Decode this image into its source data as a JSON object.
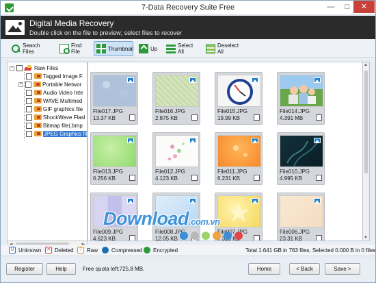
{
  "window": {
    "title": "7-Data Recovery Suite Free",
    "min": "—",
    "max": "□",
    "close": "✕"
  },
  "header": {
    "title": "Digital Media Recovery",
    "subtitle": "Double click on the file to preview; select files to recover"
  },
  "toolbar": {
    "search": "Search Files",
    "find": "Find File",
    "thumbnail": "Thumbnail",
    "up": "Up",
    "select_all": "Select All",
    "deselect_all": "Deselect All"
  },
  "tree": {
    "root": "Raw Files",
    "items": [
      {
        "label": "Tagged Image F"
      },
      {
        "label": "Portable Networ"
      },
      {
        "label": "Audio Video Inte"
      },
      {
        "label": "WAVE Multimed"
      },
      {
        "label": "GIF graphics file"
      },
      {
        "label": "ShockWave Flasl"
      },
      {
        "label": "Bitmap file(.bmp"
      },
      {
        "label": "JPEG Graphics fil"
      }
    ]
  },
  "files": [
    {
      "name": "File017.JPG",
      "size": "13.37 KB",
      "thumb": "blue-texture"
    },
    {
      "name": "File016.JPG",
      "size": "2.875 KB",
      "thumb": "green-texture"
    },
    {
      "name": "File015.JPG",
      "size": "19.99 KB",
      "thumb": "clock"
    },
    {
      "name": "File014.JPG",
      "size": "4.391 MB",
      "thumb": "family-photo"
    },
    {
      "name": "File013.JPG",
      "size": "6.256 KB",
      "thumb": "green-gradient"
    },
    {
      "name": "File012.JPG",
      "size": "4.123 KB",
      "thumb": "flowers"
    },
    {
      "name": "File011.JPG",
      "size": "6.231 KB",
      "thumb": "orange"
    },
    {
      "name": "File010.JPG",
      "size": "4.995 KB",
      "thumb": "dark-teal"
    },
    {
      "name": "File009.JPG",
      "size": "4.623 KB",
      "thumb": "purple-blocks"
    },
    {
      "name": "File008.JPG",
      "size": "12.05 KB",
      "thumb": "light-blue"
    },
    {
      "name": "File007.JPG",
      "size": "7.329 KB",
      "thumb": "yellow-star"
    },
    {
      "name": "File006.JPG",
      "size": "23.31 KB",
      "thumb": "peach"
    }
  ],
  "legend": {
    "unknown": "Unknown",
    "deleted": "Deleted",
    "raw": "Raw",
    "compressed": "Compressed",
    "encrypted": "Encrypted"
  },
  "status": "Total 1.641 GB in 763 files, Selected 0.000 B in 0 files.",
  "bottom": {
    "register": "Register",
    "help": "Help",
    "quota": "Free quota left:725.8 MB.",
    "home": "Home",
    "back": "< Back",
    "save": "Save >"
  },
  "watermark": {
    "text": "Download",
    "domain": ".com.vn"
  },
  "colors": {
    "header_bg": "#2b2b2b",
    "accent_green": "#2b9a3a",
    "selection": "#3078d0"
  }
}
